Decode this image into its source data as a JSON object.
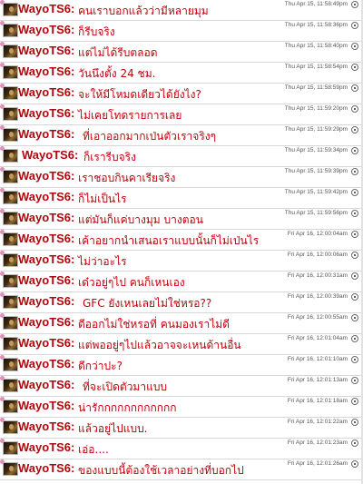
{
  "username": "WayoTS6:",
  "messages": [
    {
      "time": "Thu Apr 15, 11:58:49pm",
      "text": "คนเราบอกแล้วว่ามีหลายมุม"
    },
    {
      "time": "Thu Apr 15, 11:58:36pm",
      "text": "ก็รีบจริง"
    },
    {
      "time": "Thu Apr 15, 11:58:40pm",
      "text": "แต่ไม่ได้รีบตลอด"
    },
    {
      "time": "Thu Apr 15, 11:58:54pm",
      "text": "วันนึงตั้ง 24 ชม."
    },
    {
      "time": "Thu Apr 15, 11:58:59pm",
      "text": "จะให้มีโหมดเดียวได้ยังไง?"
    },
    {
      "time": "Thu Apr 15, 11:59:20pm",
      "text": "ไม่เคยโทดรายการเลย"
    },
    {
      "time": "Thu Apr 15, 11:59:29pm",
      "text": "ที่เอาออกมากเป่นตัวเราจริงๆ"
    },
    {
      "time": "Thu Apr 15, 11:59:34pm",
      "text": "ก็เรารีบจริง"
    },
    {
      "time": "Thu Apr 15, 11:59:39pm",
      "text": "เราชอบกินคาเรียจริง"
    },
    {
      "time": "Thu Apr 15, 11:59:42pm",
      "text": "ก็ไม่เป็นไร"
    },
    {
      "time": "Thu Apr 15, 11:59:56pm",
      "text": "แต่มันก็แค่บางมุม บางตอน"
    },
    {
      "time": "Fri Apr 16, 12:00:04am",
      "text": "เค้าอยากนำเสนอเราแบบนั้นก็ไม่เป่นไร"
    },
    {
      "time": "Fri Apr 16, 12:00:06am",
      "text": "ไม่ว่าอะไร"
    },
    {
      "time": "Fri Apr 16, 12:00:31am",
      "text": "เด๋วอยู่ๆไป คนก็เหนเอง"
    },
    {
      "time": "Fri Apr 16, 12:00:39am",
      "text": "GFC ยังเหนเลยไม่ใช่หรอ??"
    },
    {
      "time": "Fri Apr 16, 12:00:55am",
      "text": "ดีออกไม่ใช่หรอที่ คนมองเราไม่ดี"
    },
    {
      "time": "Fri Apr 16, 12:01:04am",
      "text": "แต่พออยู่ๆไปแล้วอาจจะเหนด้านอื่น"
    },
    {
      "time": "Fri Apr 16, 12:01:10am",
      "text": "ดีกว่าปะ?"
    },
    {
      "time": "Fri Apr 16, 12:01:13am",
      "text": "ที่จะเปิดตัวมาแบบ"
    },
    {
      "time": "Fri Apr 16, 12:01:18am",
      "text": "น่ารักกกกกกกกกกกก"
    },
    {
      "time": "Fri Apr 16, 12:01:22am",
      "text": "แล้วอยู่ไปแบบ."
    },
    {
      "time": "Fri Apr 16, 12:01:23am",
      "text": "เอ่อ...."
    },
    {
      "time": "Fri Apr 16, 12:01:26am",
      "text": "ของแบบนี้ต้องใช้เวลาอย่างที่บอกไป"
    }
  ]
}
